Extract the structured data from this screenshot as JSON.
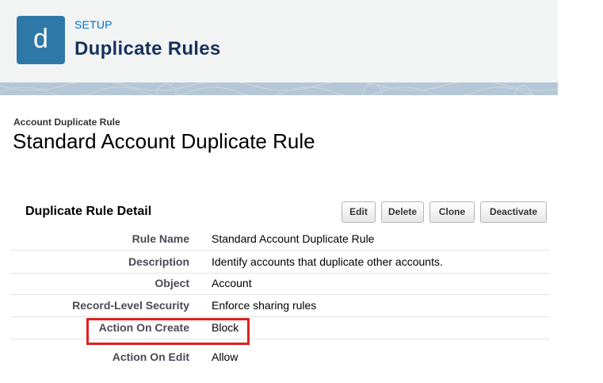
{
  "header": {
    "icon_letter": "d",
    "setup_label": "SETUP",
    "title": "Duplicate Rules",
    "icon_color": "#2e78a8",
    "title_color": "#16325c",
    "setup_color": "#0070d2"
  },
  "record": {
    "type_label": "Account Duplicate Rule",
    "title": "Standard Account Duplicate Rule"
  },
  "detail": {
    "section_title": "Duplicate Rule Detail",
    "buttons": {
      "edit": "Edit",
      "delete": "Delete",
      "clone": "Clone",
      "deactivate": "Deactivate"
    },
    "rows": [
      {
        "label": "Rule Name",
        "value": "Standard Account Duplicate Rule"
      },
      {
        "label": "Description",
        "value": "Identify accounts that duplicate other accounts."
      },
      {
        "label": "Object",
        "value": "Account"
      },
      {
        "label": "Record-Level Security",
        "value": "Enforce sharing rules"
      },
      {
        "label": "Action On Create",
        "value": "Block"
      },
      {
        "label": "Action On Edit",
        "value": "Allow"
      }
    ]
  },
  "annotation": {
    "highlight_color": "#e02020",
    "highlighted_row": "Action On Create"
  }
}
